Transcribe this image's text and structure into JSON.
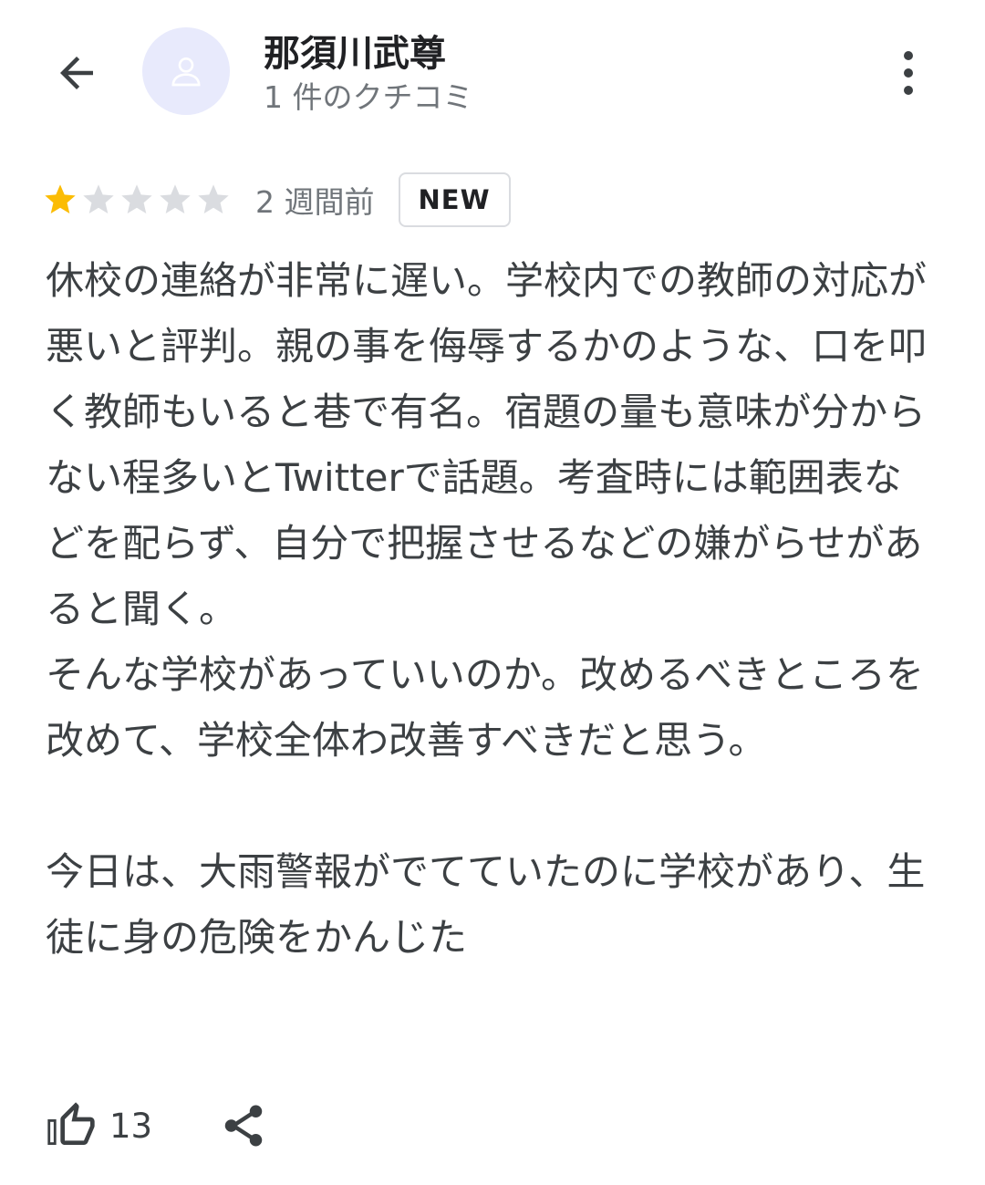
{
  "header": {
    "back_icon": "arrow-left-icon",
    "avatar_icon": "person-icon",
    "user_name": "那須川武尊",
    "review_count": "1 件のクチコミ",
    "more_icon": "more-vert-icon"
  },
  "review": {
    "rating": 1,
    "max_rating": 5,
    "star_filled_color": "#fbbc04",
    "star_empty_color": "#dadce0",
    "date": "2 週間前",
    "badge": "NEW",
    "text": "休校の連絡が非常に遅い。学校内での教師の対応が悪いと評判。親の事を侮辱するかのような、口を叩く教師もいると巷で有名。宿題の量も意味が分からない程多いとTwitterで話題。考査時には範囲表などを配らず、自分で把握させるなどの嫌がらせがあると聞く。\nそんな学校があっていいのか。改めるべきところを改めて、学校全体わ改善すべきだと思う。\n\n今日は、大雨警報がでてていたのに学校があり、生徒に身の危険をかんじた"
  },
  "actions": {
    "like_icon": "thumb-up-icon",
    "like_count": "13",
    "share_icon": "share-icon"
  }
}
